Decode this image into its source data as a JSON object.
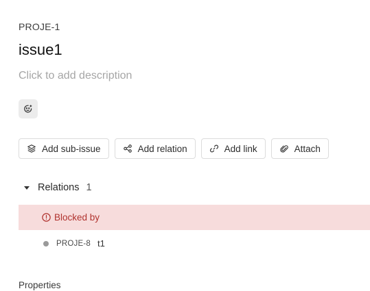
{
  "issue": {
    "key": "PROJE-1",
    "title": "issue1",
    "description_placeholder": "Click to add description"
  },
  "emoji_button": {
    "icon": "smiley-add-icon"
  },
  "actions": [
    {
      "label": "Add sub-issue",
      "icon": "layers-icon"
    },
    {
      "label": "Add relation",
      "icon": "relation-icon"
    },
    {
      "label": "Add link",
      "icon": "link-icon"
    },
    {
      "label": "Attach",
      "icon": "paperclip-icon"
    }
  ],
  "relations": {
    "label": "Relations",
    "count": "1",
    "groups": [
      {
        "label": "Blocked by",
        "icon": "blocked-icon",
        "color": "#b0322e",
        "background": "#f7dcdc",
        "items": [
          {
            "key": "PROJE-8",
            "title": "t1",
            "status_color": "#9a9a9a"
          }
        ]
      }
    ]
  },
  "properties": {
    "label": "Properties"
  }
}
